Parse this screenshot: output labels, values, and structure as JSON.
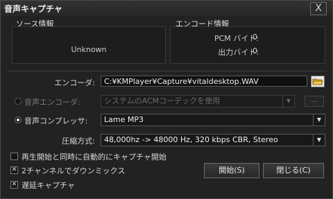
{
  "window": {
    "title": "音声キャプチャ",
    "close_label": "X"
  },
  "source": {
    "heading": "ソース情報",
    "value": "Unknown"
  },
  "encode": {
    "heading": "エンコード情報",
    "pcm_label": "PCM バイト:",
    "pcm_value": "0",
    "out_label": "出力バイト:",
    "out_value": "0"
  },
  "encoder_path": {
    "label": "エンコーダ:",
    "value": "C:¥KMPlayer¥Capture¥vitaldesktop.WAV"
  },
  "audio_encoder": {
    "label": "音声エンコーダ:",
    "selected": "システムのACMコーデックを使用",
    "more_label": "..."
  },
  "audio_compressor": {
    "label": "音声コンプレッサ:",
    "selected": "Lame MP3"
  },
  "compression": {
    "label": "圧縮方式:",
    "selected": "48,000hz -> 48000 Hz, 320 kbps CBR, Stereo"
  },
  "options": [
    {
      "label": "再生開始と同時に自動的にキャプチャ開始",
      "checked": false
    },
    {
      "label": "2チャンネルでダウンミックス",
      "checked": true
    },
    {
      "label": "遅延キャプチャ",
      "checked": true
    }
  ],
  "buttons": {
    "start": "開始(S)",
    "close": "閉じる(C)"
  },
  "colors": {
    "background": "#222222",
    "field": "#101010",
    "accent": "#e8e8e8"
  }
}
